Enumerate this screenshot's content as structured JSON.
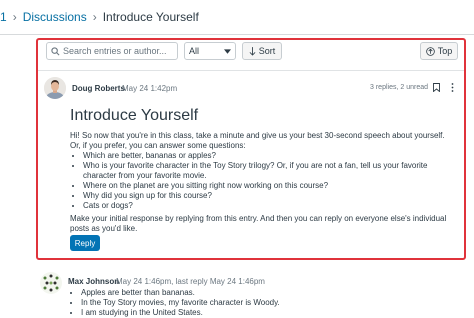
{
  "breadcrumb": {
    "root": "1",
    "section": "Discussions",
    "current": "Introduce Yourself"
  },
  "toolbar": {
    "search_placeholder": "Search entries or author...",
    "filter_value": "All",
    "sort_label": "Sort",
    "top_label": "Top"
  },
  "post": {
    "author": "Doug Roberts",
    "date": "May 24 1:42pm",
    "replies": "3 replies, 2 unread",
    "title": "Introduce Yourself",
    "intro": "Hi! So now that you're in this class, take a minute and give us your best 30-second speech about yourself. Or, if you prefer, you can answer some questions:",
    "questions": [
      "Which are better, bananas or apples?",
      "Who is your favorite character in the Toy Story trilogy? Or, if you are not a fan, tell us your favorite character from your favorite movie.",
      "Where on the planet are you sitting right now working on this course?",
      "Why did you sign up for this course?",
      "Cats or dogs?"
    ],
    "outro": "Make your initial response by replying from this entry. And then you can reply on everyone else's individual posts as you'd like.",
    "reply_label": "Reply"
  },
  "reply": {
    "author": "Max Johnson",
    "date": "May 24 1:46pm, last reply May 24 1:46pm",
    "items": [
      "Apples are better than bananas.",
      "In the Toy Story movies, my favorite character is Woody.",
      "I am studying in the United States."
    ]
  },
  "colors": {
    "link": "#0770a3",
    "highlight_border": "#e0333b",
    "primary_button": "#0374b5"
  }
}
